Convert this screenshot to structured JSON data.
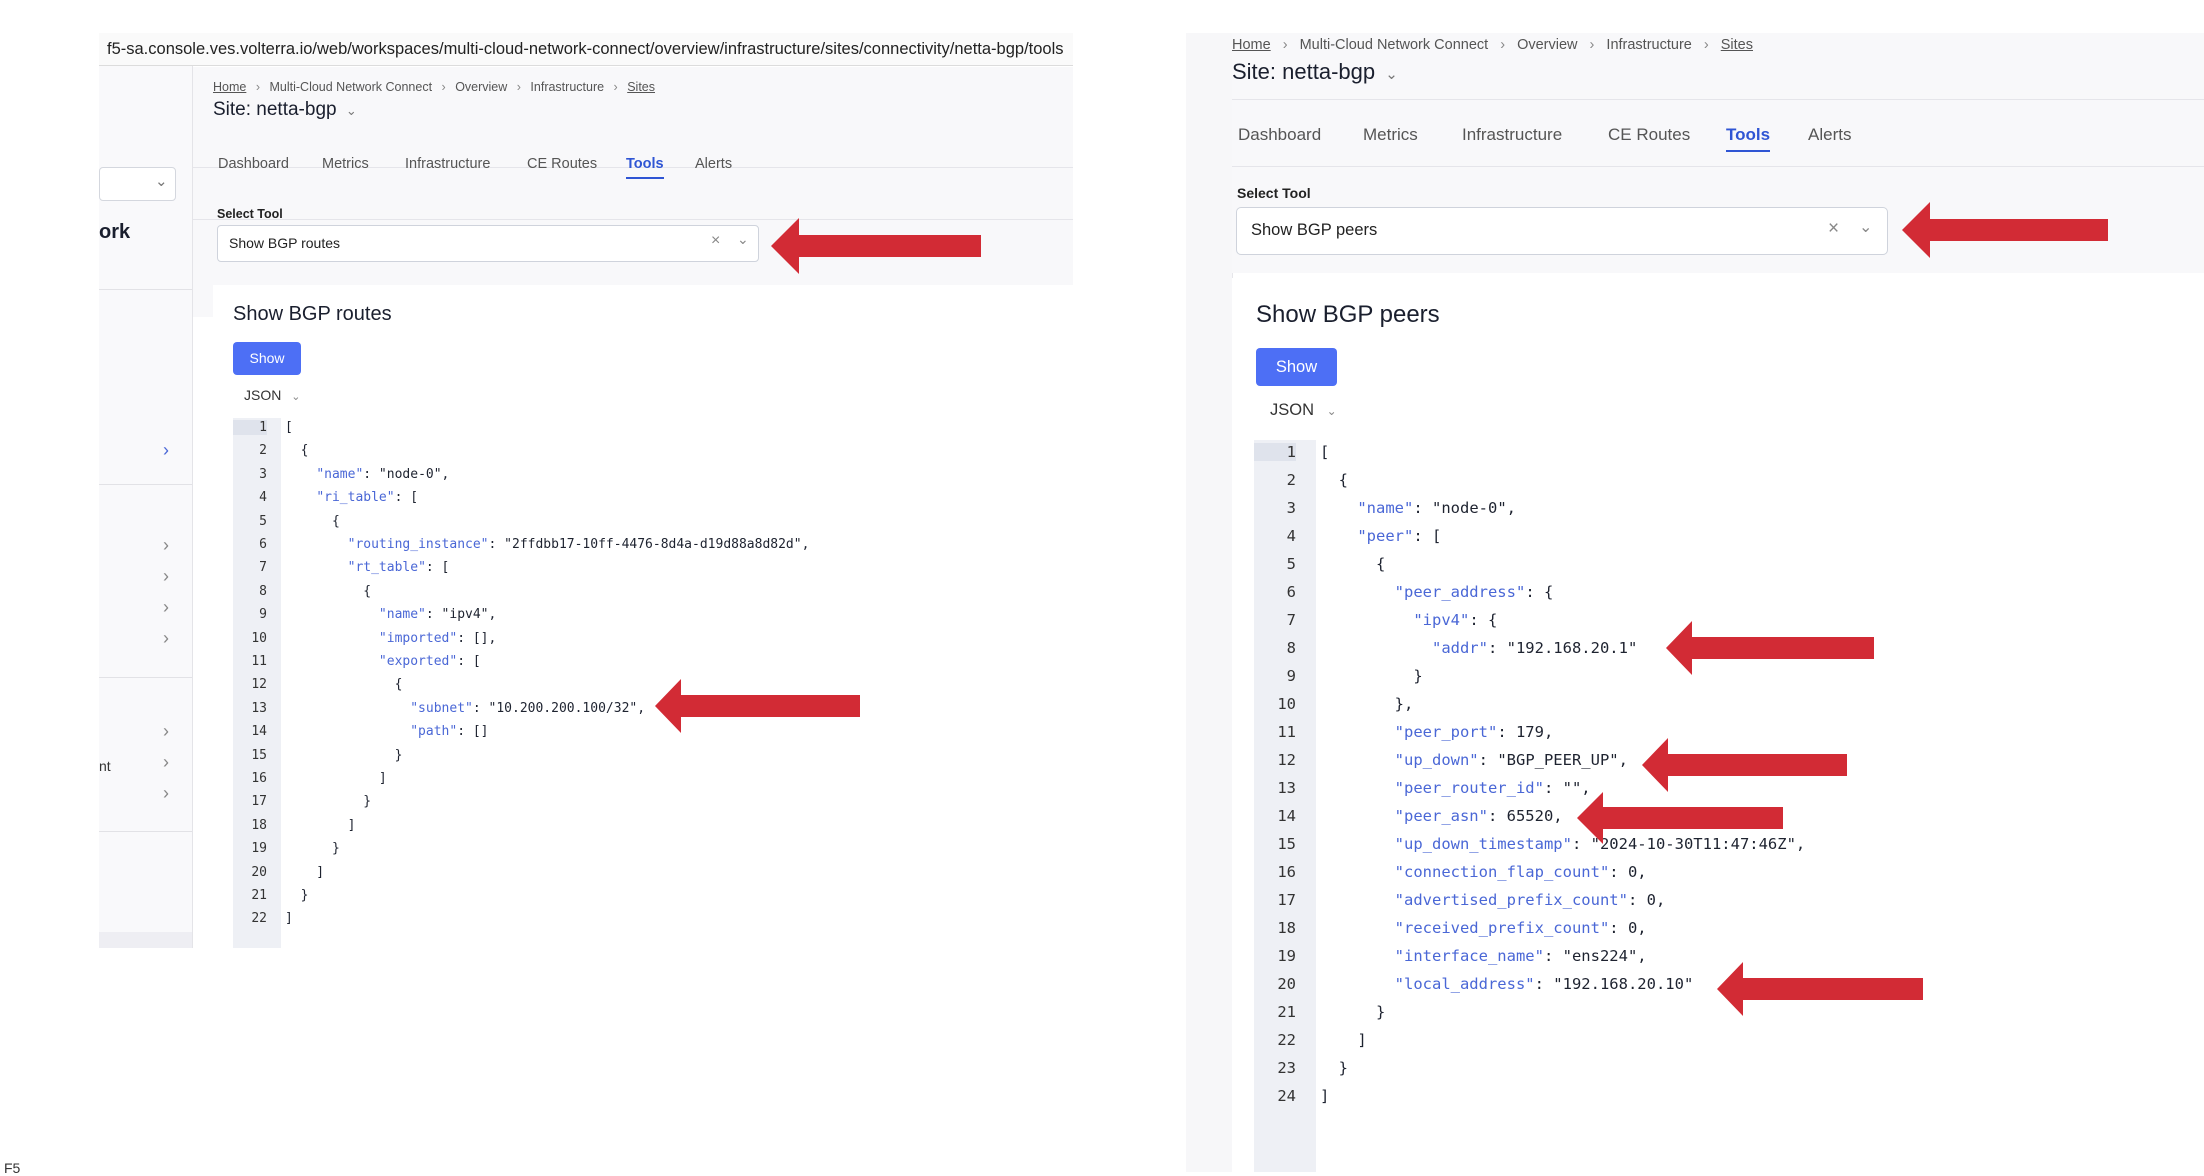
{
  "left": {
    "url": "f5-sa.console.ves.volterra.io/web/workspaces/multi-cloud-network-connect/overview/infrastructure/sites/connectivity/netta-bgp/tools",
    "sidebar_fragment": "ork",
    "sidebar_fragment2": "nt",
    "breadcrumb": [
      "Home",
      "Multi-Cloud Network Connect",
      "Overview",
      "Infrastructure",
      "Sites"
    ],
    "site_title": "Site: netta-bgp",
    "tabs": [
      "Dashboard",
      "Metrics",
      "Infrastructure",
      "CE Routes",
      "Tools",
      "Alerts"
    ],
    "active_tab": "Tools",
    "select_label": "Select Tool",
    "select_value": "Show BGP routes",
    "card_title": "Show BGP routes",
    "show_button": "Show",
    "format": "JSON",
    "code_lines": [
      "[",
      "  {",
      "    \"name\": \"node-0\",",
      "    \"ri_table\": [",
      "      {",
      "        \"routing_instance\": \"2ffdbb17-10ff-4476-8d4a-d19d88a8d82d\",",
      "        \"rt_table\": [",
      "          {",
      "            \"name\": \"ipv4\",",
      "            \"imported\": [],",
      "            \"exported\": [",
      "              {",
      "                \"subnet\": \"10.200.200.100/32\",",
      "                \"path\": []",
      "              }",
      "            ]",
      "          }",
      "        ]",
      "      }",
      "    ]",
      "  }",
      "]"
    ],
    "line_numbers": [
      "1",
      "2",
      "3",
      "4",
      "5",
      "6",
      "7",
      "8",
      "9",
      "10",
      "11",
      "12",
      "13",
      "14",
      "15",
      "16",
      "17",
      "18",
      "19",
      "20",
      "21",
      "22"
    ]
  },
  "right": {
    "breadcrumb": [
      "Home",
      "Multi-Cloud Network Connect",
      "Overview",
      "Infrastructure",
      "Sites"
    ],
    "site_title": "Site: netta-bgp",
    "tabs": [
      "Dashboard",
      "Metrics",
      "Infrastructure",
      "CE Routes",
      "Tools",
      "Alerts"
    ],
    "active_tab": "Tools",
    "select_label": "Select Tool",
    "select_value": "Show BGP peers",
    "card_title": "Show BGP peers",
    "show_button": "Show",
    "format": "JSON",
    "code_lines": [
      "[",
      "  {",
      "    \"name\": \"node-0\",",
      "    \"peer\": [",
      "      {",
      "        \"peer_address\": {",
      "          \"ipv4\": {",
      "            \"addr\": \"192.168.20.1\"",
      "          }",
      "        },",
      "        \"peer_port\": 179,",
      "        \"up_down\": \"BGP_PEER_UP\",",
      "        \"peer_router_id\": \"\",",
      "        \"peer_asn\": 65520,",
      "        \"up_down_timestamp\": \"2024-10-30T11:47:46Z\",",
      "        \"connection_flap_count\": 0,",
      "        \"advertised_prefix_count\": 0,",
      "        \"received_prefix_count\": 0,",
      "        \"interface_name\": \"ens224\",",
      "        \"local_address\": \"192.168.20.10\"",
      "      }",
      "    ]",
      "  }",
      "]"
    ],
    "line_numbers": [
      "1",
      "2",
      "3",
      "4",
      "5",
      "6",
      "7",
      "8",
      "9",
      "10",
      "11",
      "12",
      "13",
      "14",
      "15",
      "16",
      "17",
      "18",
      "19",
      "20",
      "21",
      "22",
      "23",
      "24"
    ]
  },
  "footer_fragment": "F5",
  "colors": {
    "accent": "#2f55d4",
    "button": "#4d6ff5",
    "arrow": "#d22b35",
    "json_key": "#4a67d6"
  }
}
